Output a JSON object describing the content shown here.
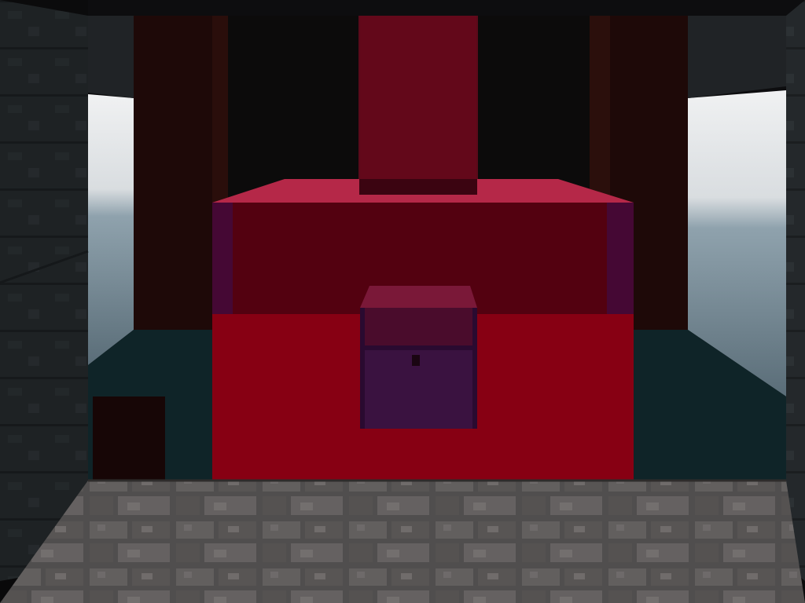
{
  "scene": {
    "kind": "first-person-voxel-view",
    "hud_visible": false
  },
  "colors": {
    "sky": "#e6e8ea",
    "distant_water": "#5d6f7a",
    "room_floor_far": "#0f2428",
    "ceiling": "#0d0d0f",
    "stone_wall": "#262a2d",
    "dark_pillar": "#1e0908",
    "translucent_red_block": "#b0102a",
    "red_block_top": "#c8304f",
    "chest_purple": "#3a1240",
    "cobblestone_light": "#6a6665",
    "cobblestone_dark": "#3d3b3a"
  },
  "objects": [
    "left-stone-wall",
    "right-stone-wall",
    "ceiling",
    "sky-opening-left",
    "sky-opening-right",
    "back-pillar-left",
    "back-pillar-right",
    "red-glass-column",
    "red-glass-block-large",
    "chest",
    "small-dark-block",
    "stone-brick-floor"
  ]
}
